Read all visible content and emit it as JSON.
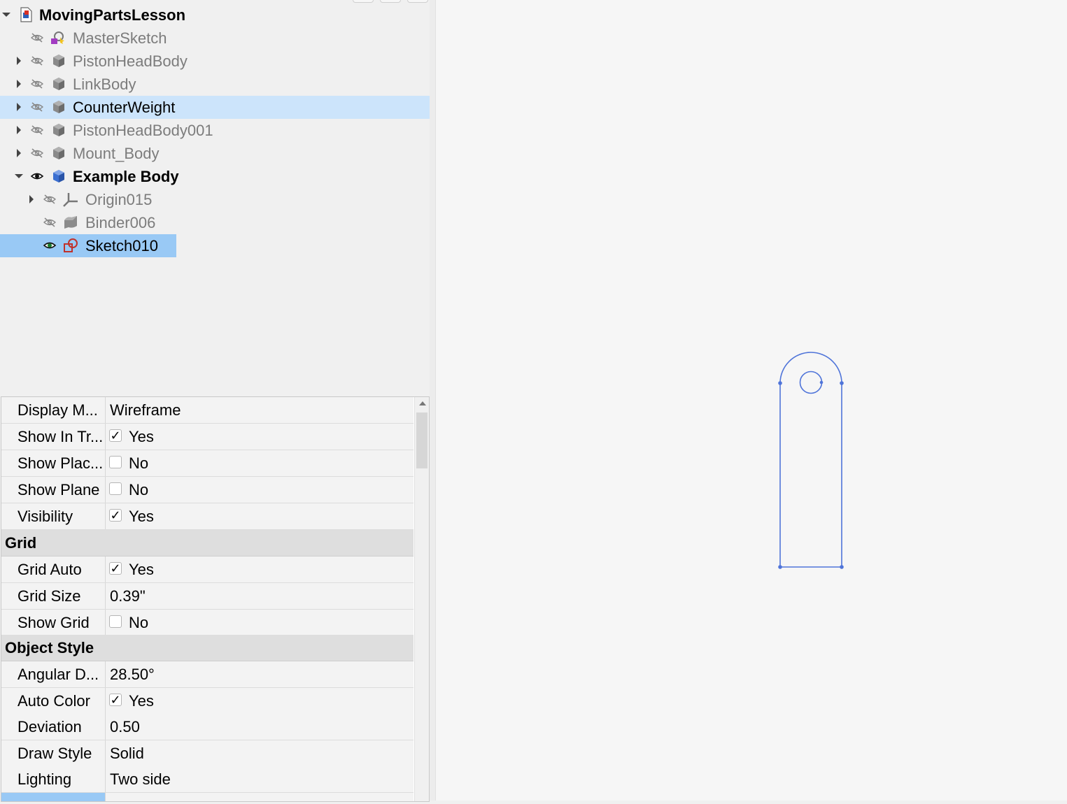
{
  "tree": {
    "items": [
      {
        "label": "MovingPartsLesson",
        "style": "bold",
        "icon": "document-icon"
      },
      {
        "label": "MasterSketch",
        "style": "gray",
        "icon": "master-sketch-icon"
      },
      {
        "label": "PistonHeadBody",
        "style": "gray",
        "icon": "body-icon"
      },
      {
        "label": "LinkBody",
        "style": "gray",
        "icon": "body-icon"
      },
      {
        "label": "CounterWeight",
        "style": "black",
        "icon": "body-icon"
      },
      {
        "label": "PistonHeadBody001",
        "style": "gray",
        "icon": "body-icon"
      },
      {
        "label": "Mount_Body",
        "style": "gray",
        "icon": "body-icon"
      },
      {
        "label": "Example Body",
        "style": "bold",
        "icon": "active-body-icon"
      },
      {
        "label": "Origin015",
        "style": "gray",
        "icon": "origin-icon"
      },
      {
        "label": "Binder006",
        "style": "gray",
        "icon": "binder-icon"
      },
      {
        "label": "Sketch010",
        "style": "black",
        "icon": "sketch-icon"
      }
    ]
  },
  "properties": {
    "rows": [
      {
        "name": "Display M...",
        "value": "Wireframe"
      },
      {
        "name": "Show In Tr...",
        "value": "Yes",
        "checked": true
      },
      {
        "name": "Show Plac...",
        "value": "No",
        "checked": false
      },
      {
        "name": "Show Plane",
        "value": "No",
        "checked": false
      },
      {
        "name": "Visibility",
        "value": "Yes",
        "checked": true
      }
    ],
    "grid_group": "Grid",
    "grid_rows": [
      {
        "name": "Grid Auto",
        "value": "Yes",
        "checked": true
      },
      {
        "name": "Grid Size",
        "value": "0.39\""
      },
      {
        "name": "Show Grid",
        "value": "No",
        "checked": false
      }
    ],
    "style_group": "Object Style",
    "style_rows": [
      {
        "name": "Angular D...",
        "value": "28.50°"
      },
      {
        "name": "Auto Color",
        "value": "Yes",
        "checked": true
      },
      {
        "name": "Deviation",
        "value": "0.50"
      },
      {
        "name": "Draw Style",
        "value": "Solid"
      },
      {
        "name": "Lighting",
        "value": "Two side"
      }
    ],
    "checkmark": "✓"
  },
  "viewport": {
    "sketch_color": "#4f74d9"
  }
}
